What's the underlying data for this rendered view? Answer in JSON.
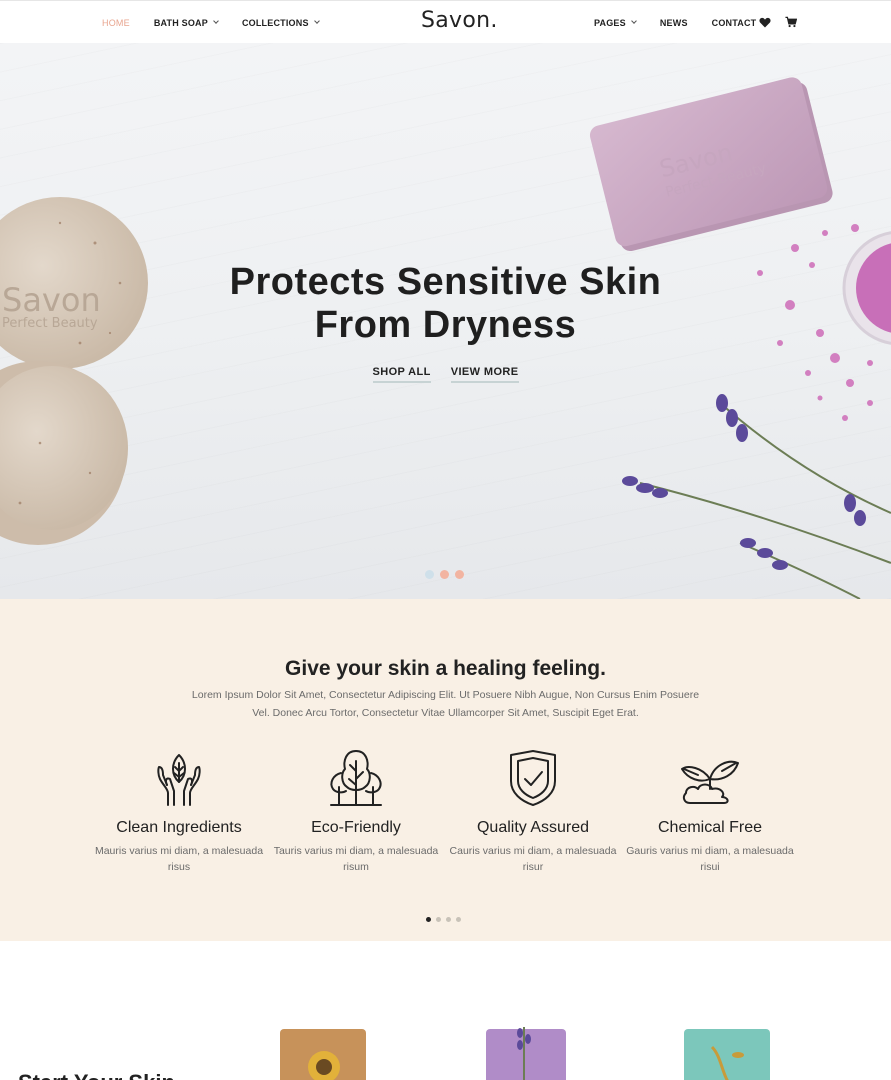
{
  "header": {
    "logo": "Savon.",
    "nav_left": [
      {
        "label": "HOME",
        "active": true,
        "dropdown": false
      },
      {
        "label": "BATH SOAP",
        "active": false,
        "dropdown": true
      },
      {
        "label": "COLLECTIONS",
        "active": false,
        "dropdown": true
      }
    ],
    "nav_right": [
      {
        "label": "PAGES",
        "dropdown": true
      },
      {
        "label": "NEWS",
        "dropdown": false
      },
      {
        "label": "CONTACT",
        "dropdown": false
      }
    ],
    "icons": [
      "heart-icon",
      "cart-icon"
    ]
  },
  "hero": {
    "title_line1": "Protects Sensitive Skin",
    "title_line2": "From Dryness",
    "shop_all": "SHOP ALL",
    "view_more": "VIEW MORE",
    "slide_dots": [
      "#cfe0ea",
      "#f2b4a1",
      "#f2b4a1"
    ],
    "soap_stamp_brand": "Savon",
    "soap_stamp_tagline": "Perfect Beauty"
  },
  "features": {
    "heading": "Give your skin a healing feeling.",
    "intro_line1": "Lorem Ipsum Dolor Sit Amet, Consectetur Adipiscing Elit. Ut Posuere Nibh Augue, Non Cursus Enim Posuere",
    "intro_line2": "Vel. Donec Arcu Tortor, Consectetur Vitae Ullamcorper Sit Amet, Suscipit Eget Erat.",
    "items": [
      {
        "icon": "hands-leaf-icon",
        "title": "Clean Ingredients",
        "text1": "Mauris varius mi diam, a malesuada",
        "text2": "risus"
      },
      {
        "icon": "trees-icon",
        "title": "Eco-Friendly",
        "text1": "Tauris varius mi diam, a malesuada",
        "text2": "risum"
      },
      {
        "icon": "shield-check-icon",
        "title": "Quality Assured",
        "text1": "Cauris varius mi diam, a malesuada",
        "text2": "risur"
      },
      {
        "icon": "cloud-leaves-icon",
        "title": "Chemical Free",
        "text1": "Gauris varius mi diam, a malesuada",
        "text2": "risui"
      }
    ],
    "pagination_active": 1,
    "pagination_count": 4
  },
  "products": {
    "heading": "Start Your Skin",
    "items": [
      {
        "name": "sunflower-soap",
        "color": "#c7925a"
      },
      {
        "name": "lavender-soap",
        "color": "#b08cc8"
      },
      {
        "name": "mint-soap",
        "color": "#7cc7bb"
      }
    ]
  },
  "colors": {
    "accent": "#e8a58f",
    "features_bg": "#f9f0e5"
  }
}
